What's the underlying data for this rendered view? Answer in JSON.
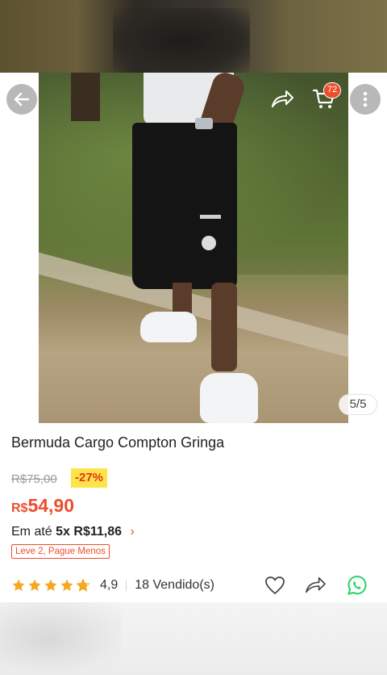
{
  "header": {
    "cart_badge": "72",
    "icons": [
      "back-arrow-icon",
      "share-icon",
      "cart-icon",
      "more-vertical-icon"
    ]
  },
  "gallery": {
    "counter": "5/5"
  },
  "product": {
    "title": "Bermuda Cargo Compton Gringa",
    "old_price": "R$75,00",
    "discount": "-27%",
    "price_currency": "R$",
    "price_value": "54,90",
    "installments_prefix": "Em até",
    "installments_value": "5x R$11,86",
    "promo_tag": "Leve 2, Pague Menos",
    "rating": "4,9",
    "rating_fraction": 0.98,
    "sold": "18 Vendido(s)"
  },
  "actions": {
    "icons": [
      "heart-icon",
      "share-icon",
      "whatsapp-icon"
    ]
  },
  "colors": {
    "accent": "#ee4d2d",
    "discount_bg": "#ffe34a",
    "star": "#f5a623",
    "whatsapp": "#25d366"
  }
}
